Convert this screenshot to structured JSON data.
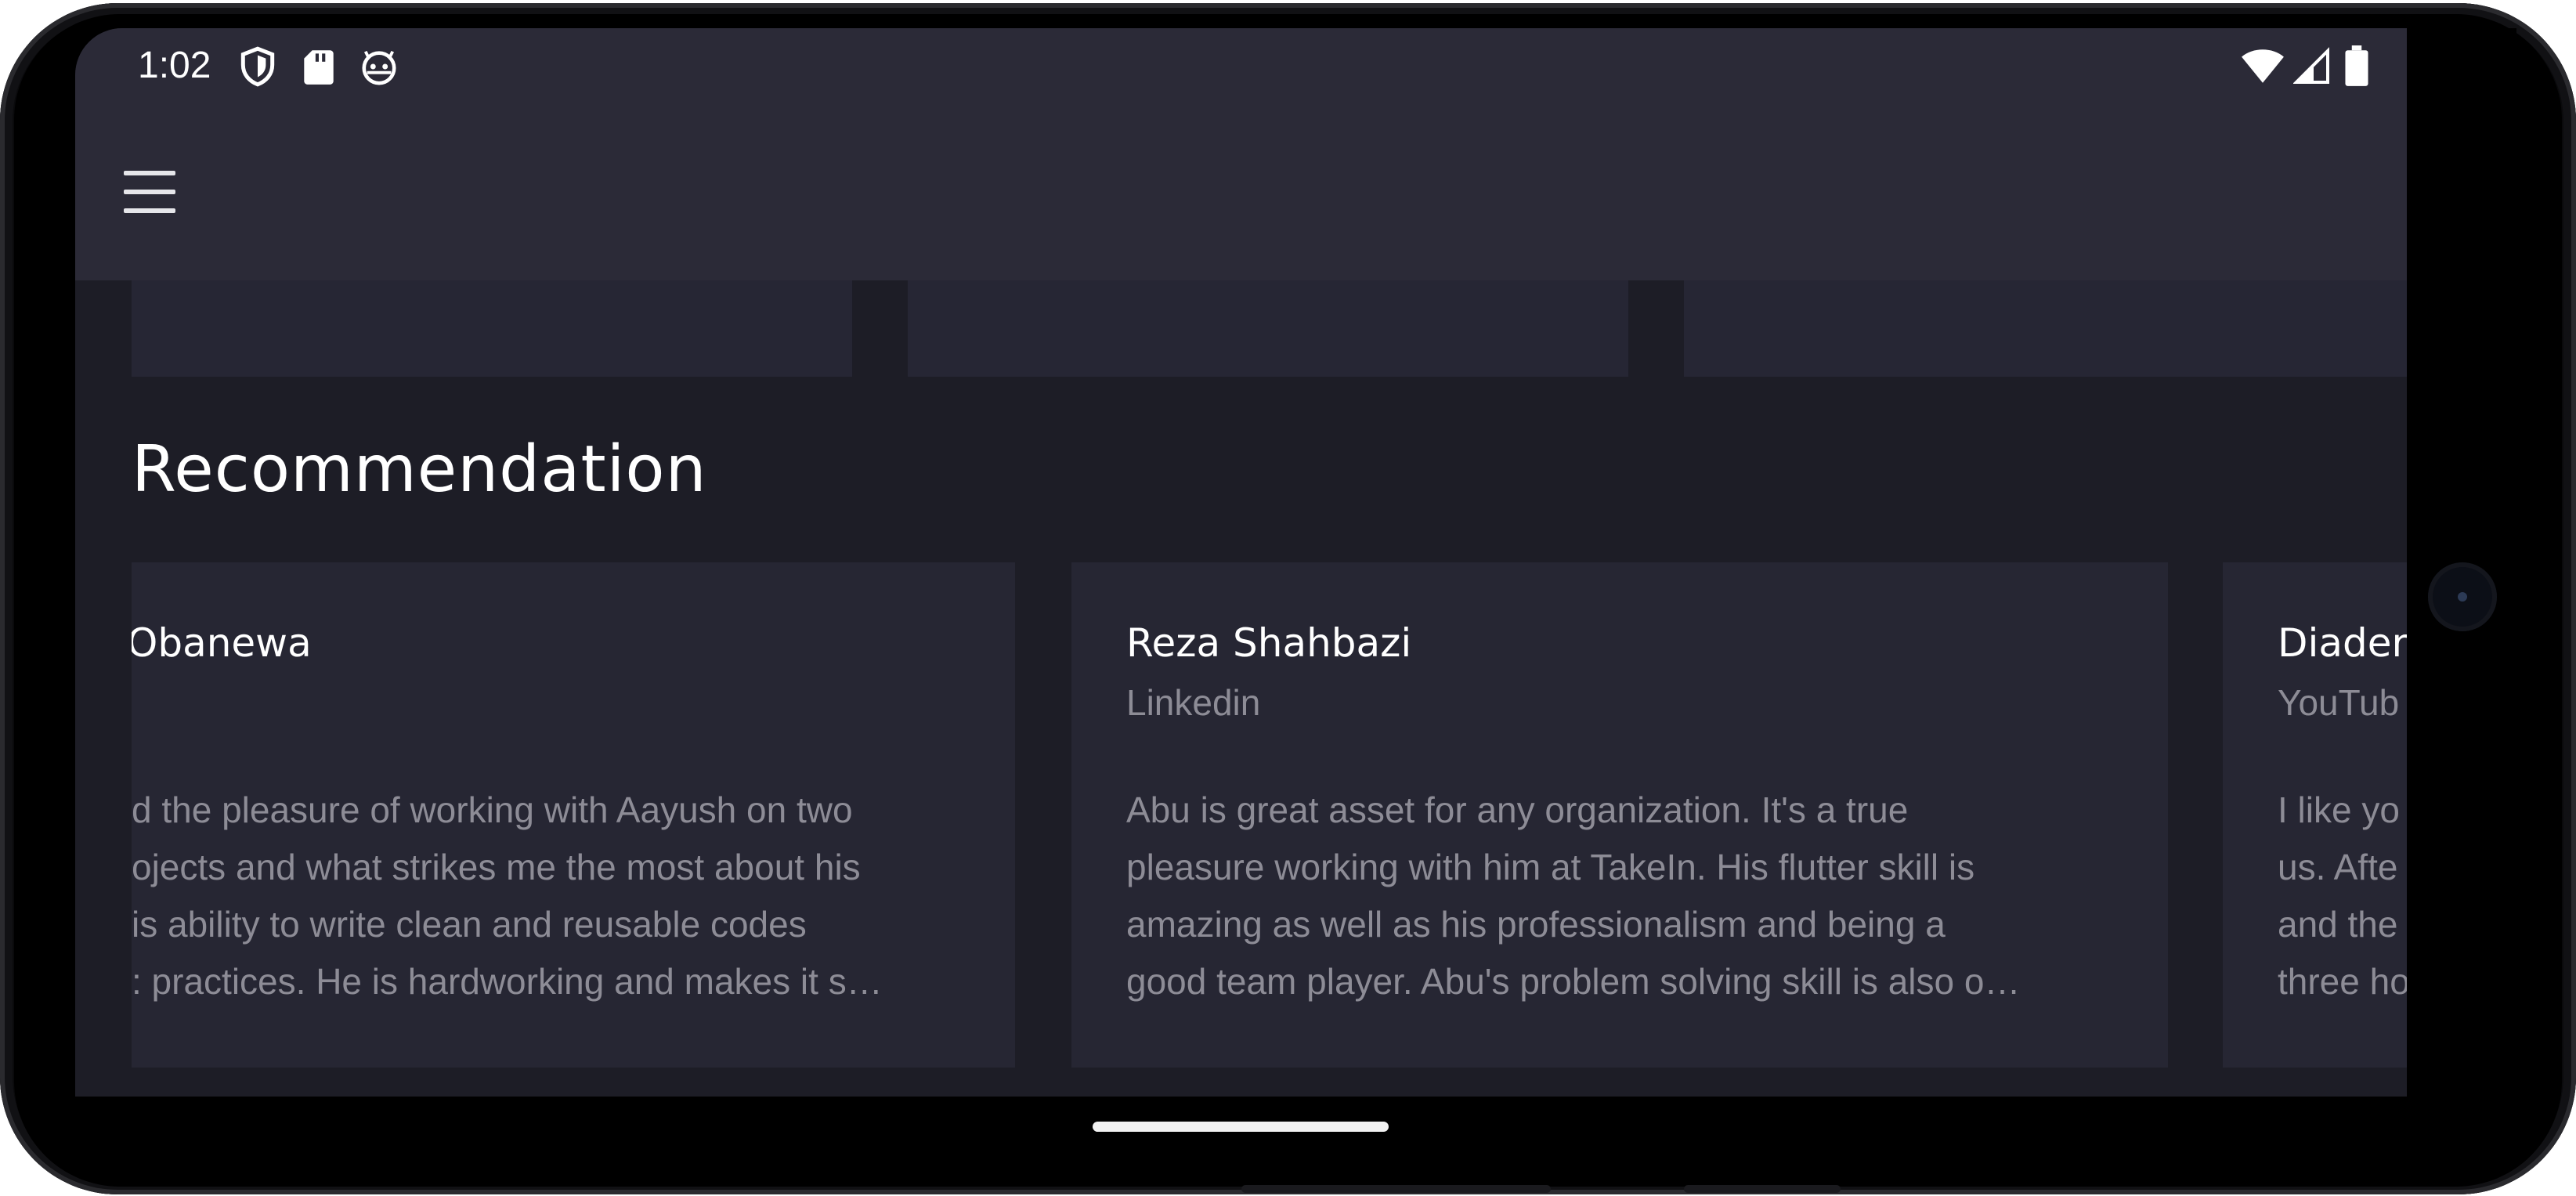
{
  "status_bar": {
    "time": "1:02",
    "left_icons": [
      "shield-icon",
      "sd-card-icon",
      "android-face-icon"
    ],
    "right_icons": [
      "wifi-icon",
      "signal-icon",
      "battery-icon"
    ]
  },
  "app_bar": {
    "menu_icon": "hamburger-menu-icon"
  },
  "section": {
    "title": "Recommendation"
  },
  "recommendations": [
    {
      "name": "Obanewa",
      "source": "",
      "lines": [
        "d the pleasure of working with Aayush on two",
        "ojects and what strikes me the most about his",
        "is ability to write clean and reusable codes",
        ": practices. He is hardworking and makes it s…"
      ]
    },
    {
      "name": "Reza Shahbazi",
      "source": "Linkedin",
      "lines": [
        "Abu is great asset for any organization. It's a true",
        "pleasure working with him at TakeIn. His flutter skill is",
        "amazing as well as his professionalism and being a",
        "good team player. Abu's problem solving skill is also o…"
      ]
    },
    {
      "name": "Diader",
      "source": "YouTub",
      "lines": [
        "I like yo",
        "us. Afte",
        "and the",
        "three ho"
      ]
    }
  ],
  "colors": {
    "background": "#1d1d26",
    "app_bar": "#2b2a37",
    "card": "#262633",
    "primary_text": "#ffffff",
    "secondary_text": "#8d8c96"
  }
}
